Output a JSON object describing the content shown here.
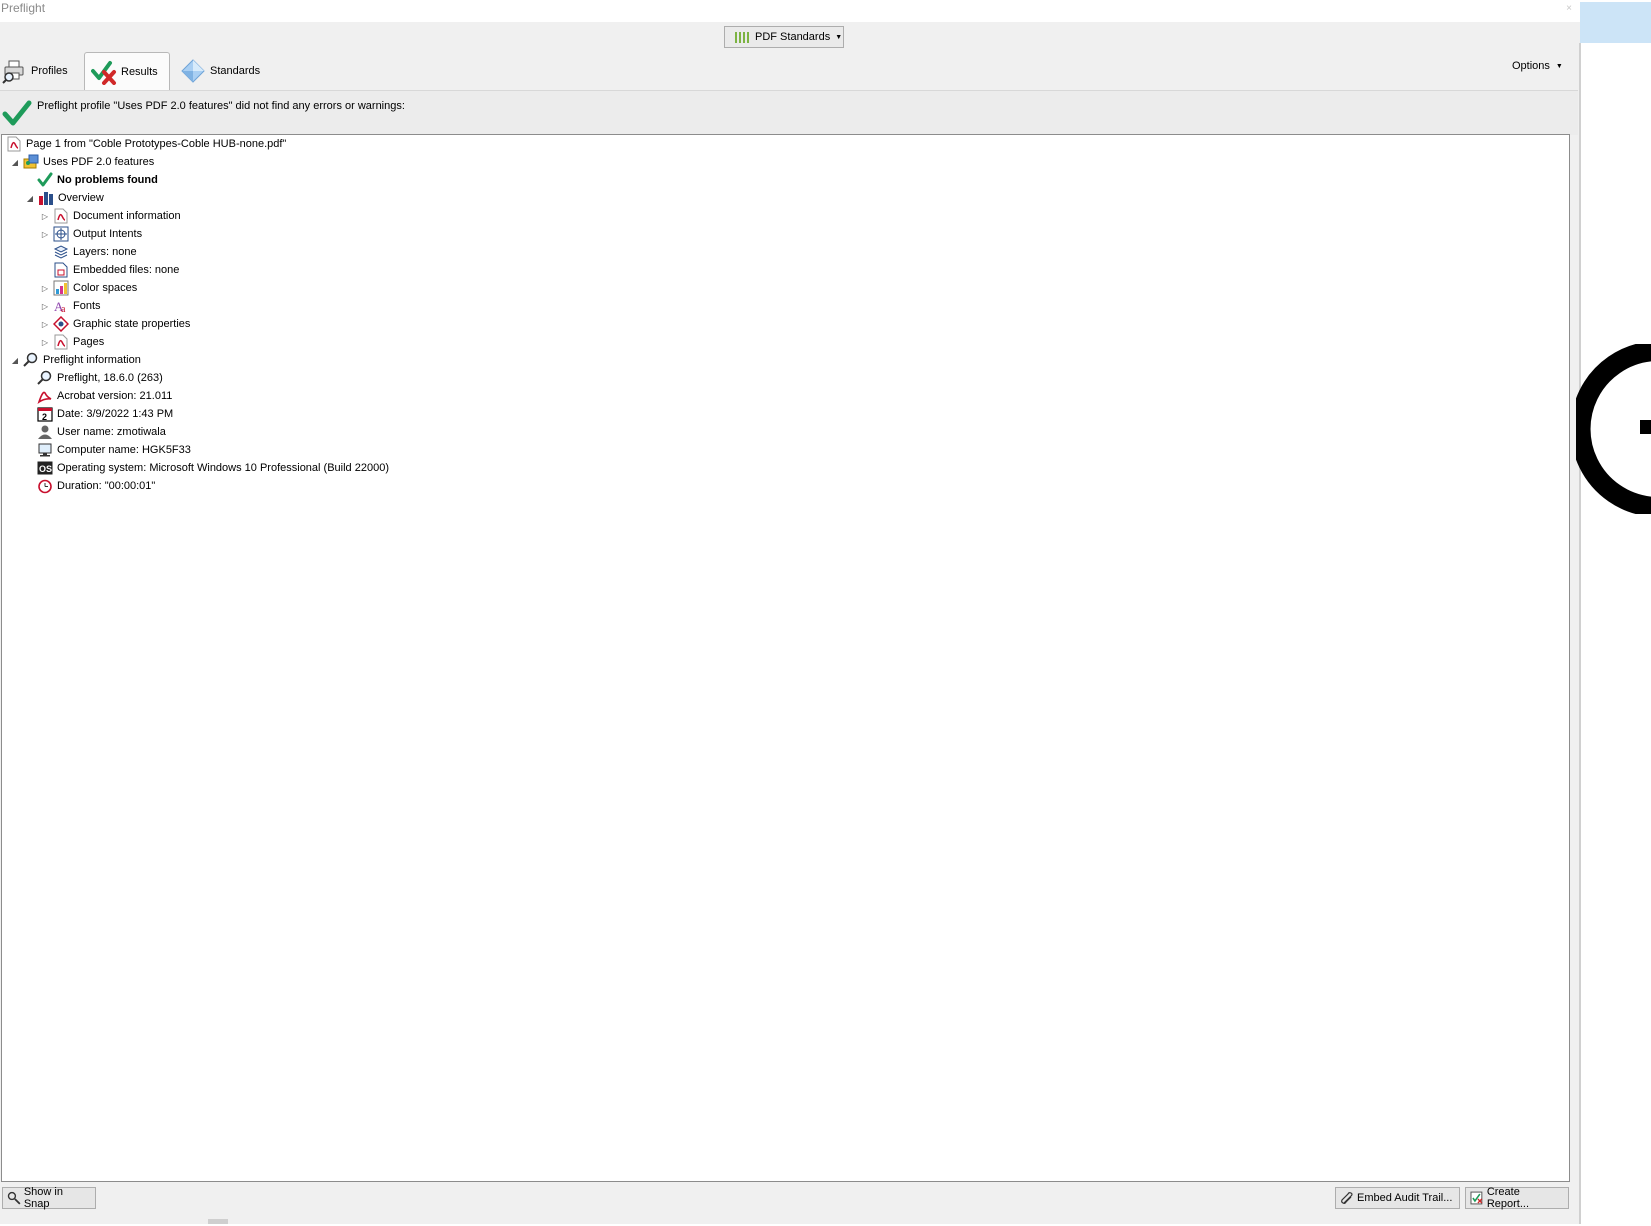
{
  "window": {
    "title": "Preflight",
    "close_glyph": "×"
  },
  "toolbar": {
    "standards_button": "PDF Standards",
    "options_label": "Options"
  },
  "tabs": [
    {
      "label": "Profiles",
      "icon": "printer-magnifier-icon"
    },
    {
      "label": "Results",
      "icon": "check-cross-icon",
      "selected": true
    },
    {
      "label": "Standards",
      "icon": "diamond-icon"
    }
  ],
  "banner": {
    "message": "Preflight profile \"Uses PDF 2.0 features\" did not find any errors or warnings:"
  },
  "tree": {
    "root": "Page 1 from \"Coble Prototypes-Coble HUB-none.pdf\"",
    "profile": "Uses PDF 2.0 features",
    "no_problems": "No problems found",
    "overview": "Overview",
    "overview_items": [
      "Document information",
      "Output Intents",
      "Layers: none",
      "Embedded files: none",
      "Color spaces",
      "Fonts",
      "Graphic state properties",
      "Pages"
    ],
    "preflight_info": "Preflight information",
    "info_items": [
      "Preflight, 18.6.0 (263)",
      "Acrobat version: 21.011",
      "Date: 3/9/2022 1:43 PM",
      "User name: zmotiwala",
      "Computer name: HGK5F33",
      "Operating system: Microsoft Windows 10 Professional (Build 22000)",
      "Duration: \"00:00:01\""
    ]
  },
  "footer": {
    "show_in_snap": "Show in Snap",
    "embed_audit_trail": "Embed Audit Trail...",
    "create_report": "Create Report..."
  },
  "colors": {
    "accent_green": "#1e9b5a",
    "error_red": "#d02828",
    "pdf_red": "#c8102e",
    "selection_blue": "#cce4f7"
  }
}
